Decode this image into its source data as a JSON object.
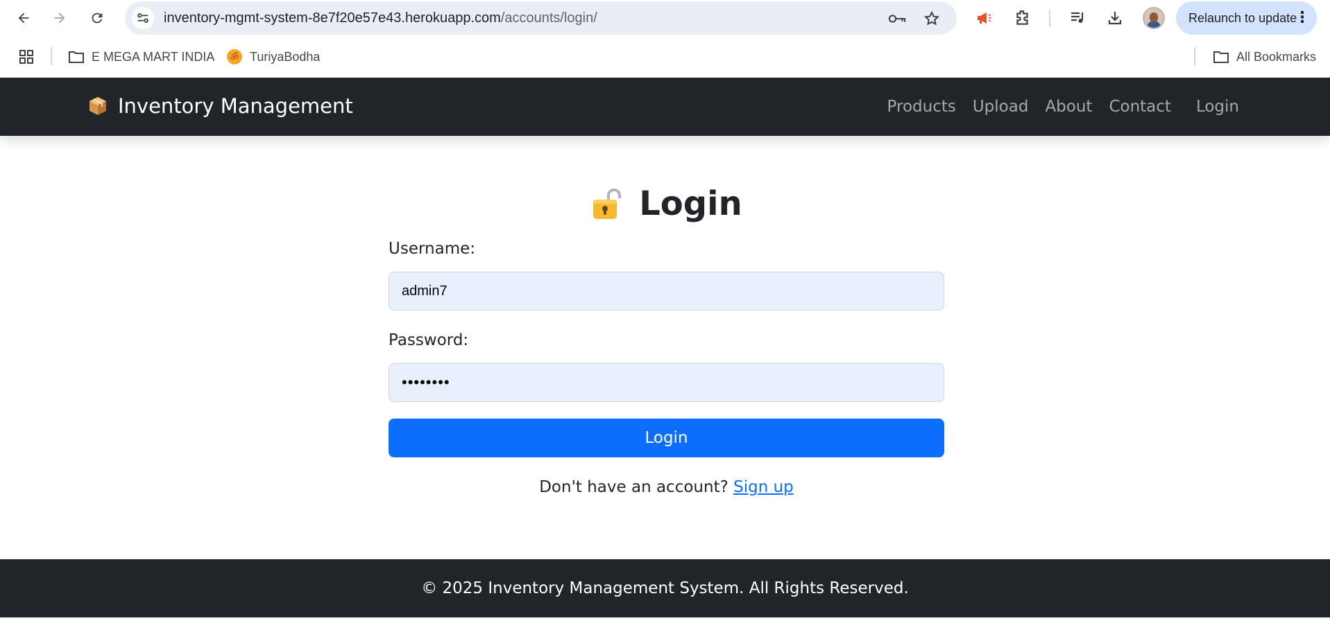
{
  "browser": {
    "url_host": "inventory-mgmt-system-8e7f20e57e43.herokuapp.com",
    "url_path": "/accounts/login/",
    "relaunch_label": "Relaunch to update",
    "icons": [
      "back-icon",
      "forward-icon",
      "reload-icon",
      "site-info-icon",
      "password-key-icon",
      "bookmark-star-icon",
      "announcement-icon",
      "extensions-icon",
      "media-icon",
      "download-icon",
      "profile-avatar",
      "menu-dots-icon"
    ]
  },
  "bookmarks": {
    "items": [
      {
        "label": "E MEGA MART INDIA",
        "icon": "folder-icon"
      },
      {
        "label": "TuriyaBodha",
        "icon": "om-icon"
      }
    ],
    "all_label": "All Bookmarks"
  },
  "site": {
    "brand": "Inventory Management",
    "nav": [
      "Products",
      "Upload",
      "About",
      "Contact",
      "Login"
    ],
    "colors": {
      "navbar": "#212529",
      "primary": "#0d6efd",
      "input_bg": "#e8f0fe"
    }
  },
  "login": {
    "title": "Login",
    "username_label": "Username:",
    "username_value": "admin7",
    "password_label": "Password:",
    "password_value": "••••••••",
    "submit_label": "Login",
    "signup_prompt": "Don't have an account?",
    "signup_link": "Sign up"
  },
  "footer": {
    "text": "© 2025 Inventory Management System. All Rights Reserved."
  }
}
